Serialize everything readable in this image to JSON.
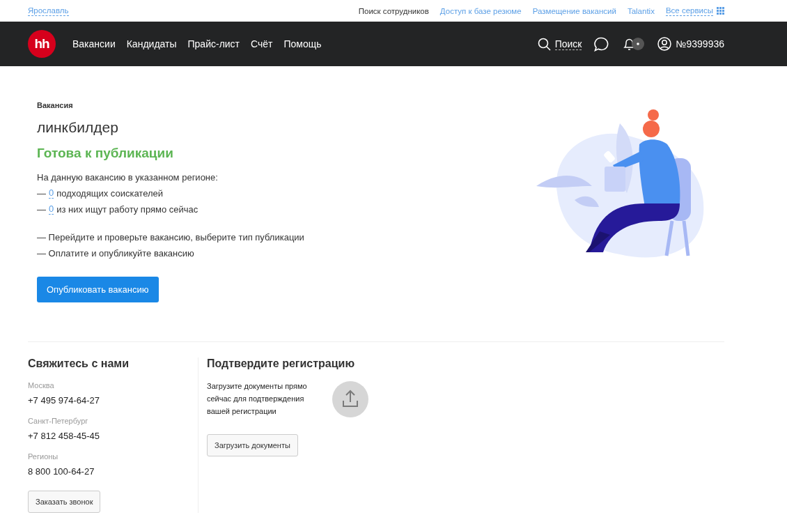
{
  "top_bar": {
    "city": "Ярославль",
    "links": [
      {
        "label": "Поиск сотрудников",
        "kind": "plain"
      },
      {
        "label": "Доступ к базе резюме",
        "kind": "link"
      },
      {
        "label": "Размещение вакансий",
        "kind": "link"
      },
      {
        "label": "Talantix",
        "kind": "link"
      },
      {
        "label": "Все сервисы",
        "kind": "menu"
      }
    ]
  },
  "nav": {
    "logo": "hh",
    "items": [
      "Вакансии",
      "Кандидаты",
      "Прайс-лист",
      "Счёт",
      "Помощь"
    ],
    "search": "Поиск",
    "account": "№9399936"
  },
  "vacancy": {
    "label": "Вакансия",
    "title": "линкбилдер",
    "status": "Готова к публикации",
    "intro": "На данную вакансию в указанном регионе:",
    "stats": [
      {
        "prefix": "—",
        "count": "0",
        "text": "подходящих соискателей"
      },
      {
        "prefix": "—",
        "count": "0",
        "text": "из них ищут работу прямо сейчас"
      }
    ],
    "steps": [
      "— Перейдите и проверьте вакансию, выберите тип публикации",
      "— Оплатите и опубликуйте вакансию"
    ],
    "button": "Опубликовать вакансию"
  },
  "contacts": {
    "title": "Свяжитесь с нами",
    "phones": [
      {
        "city": "Москва",
        "number": "+7 495 974-64-27"
      },
      {
        "city": "Санкт-Петербург",
        "number": "+7 812 458-45-45"
      },
      {
        "city": "Регионы",
        "number": "8 800 100-64-27"
      }
    ],
    "button": "Заказать звонок"
  },
  "registration": {
    "title": "Подтвердите регистрацию",
    "text": "Загрузите документы прямо сейчас для подтверждения вашей регистрации",
    "button": "Загрузить документы"
  }
}
